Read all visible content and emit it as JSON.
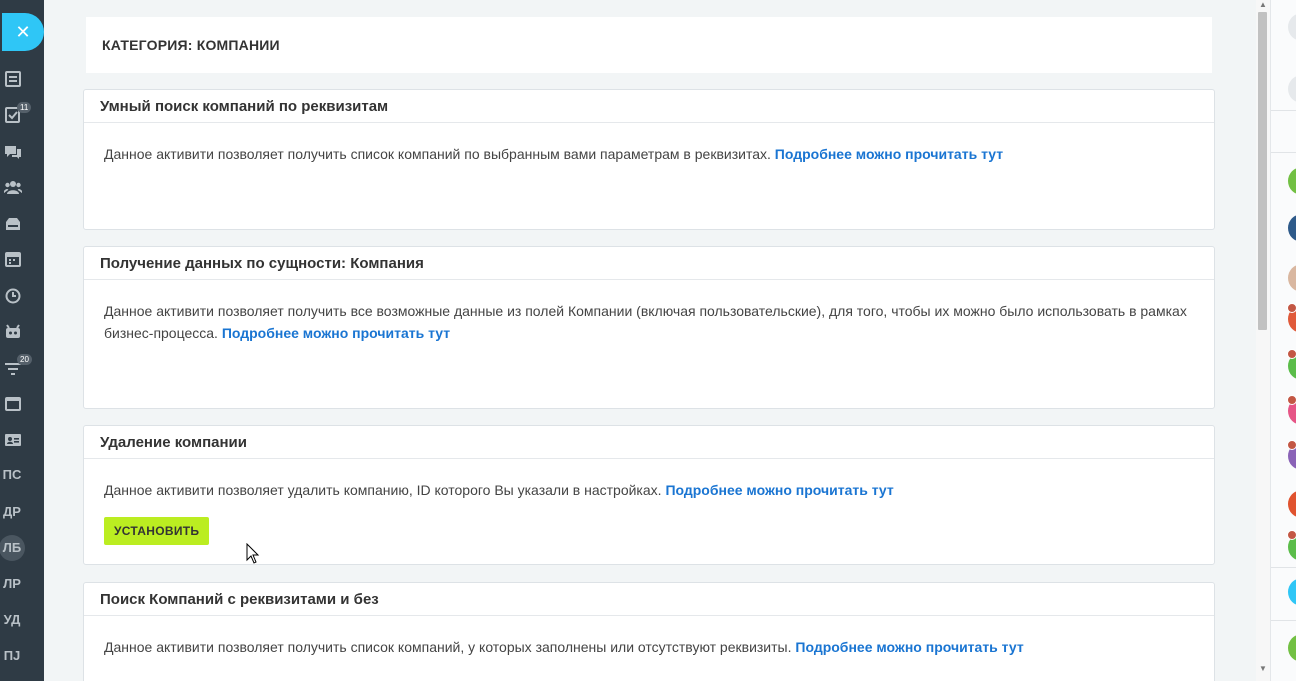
{
  "sidebar": {
    "close_icon_glyph": "✕",
    "badges": {
      "tasks": "11",
      "filters": "20"
    },
    "user_initials": [
      "ПС",
      "ДР",
      "ЛБ",
      "ЛР",
      "УД",
      "ПJ"
    ]
  },
  "header": {
    "title": "КАТЕГОРИЯ: КОМПАНИИ"
  },
  "cards": [
    {
      "title": "Умный поиск компаний по реквизитам",
      "text": "Данное активити позволяет получить список компаний по выбранным вами параметрам в реквизитах.",
      "link": "Подробнее можно прочитать тут"
    },
    {
      "title": "Получение данных по сущности: Компания",
      "text": "Данное активити позволяет получить все возможные данные из полей Компании (включая пользовательские), для того, чтобы их можно было использовать в рамках бизнес-процесса.",
      "link": "Подробнее можно прочитать тут"
    },
    {
      "title": "Удаление компании",
      "text": "Данное активити позволяет удалить компанию, ID которого Вы указали в настройках.",
      "link": "Подробнее можно прочитать тут",
      "button": "УСТАНОВИТЬ"
    },
    {
      "title": "Поиск Компаний с реквизитами и без",
      "text": "Данное активити позволяет получить список компаний, у которых заполнены или отсутствуют реквизиты.",
      "link": "Подробнее можно прочитать тут"
    }
  ],
  "colors": {
    "accent": "#2fc6f6",
    "link": "#1a75d2",
    "install_button": "#bbed21",
    "sidebar_bg": "#2f3b45"
  },
  "icons": [
    "close-icon",
    "feed-icon",
    "tasks-icon",
    "chat-icon",
    "groups-icon",
    "drive-icon",
    "calendar-icon",
    "time-icon",
    "robot-icon",
    "filter-icon",
    "sites-icon",
    "contacts-icon"
  ]
}
